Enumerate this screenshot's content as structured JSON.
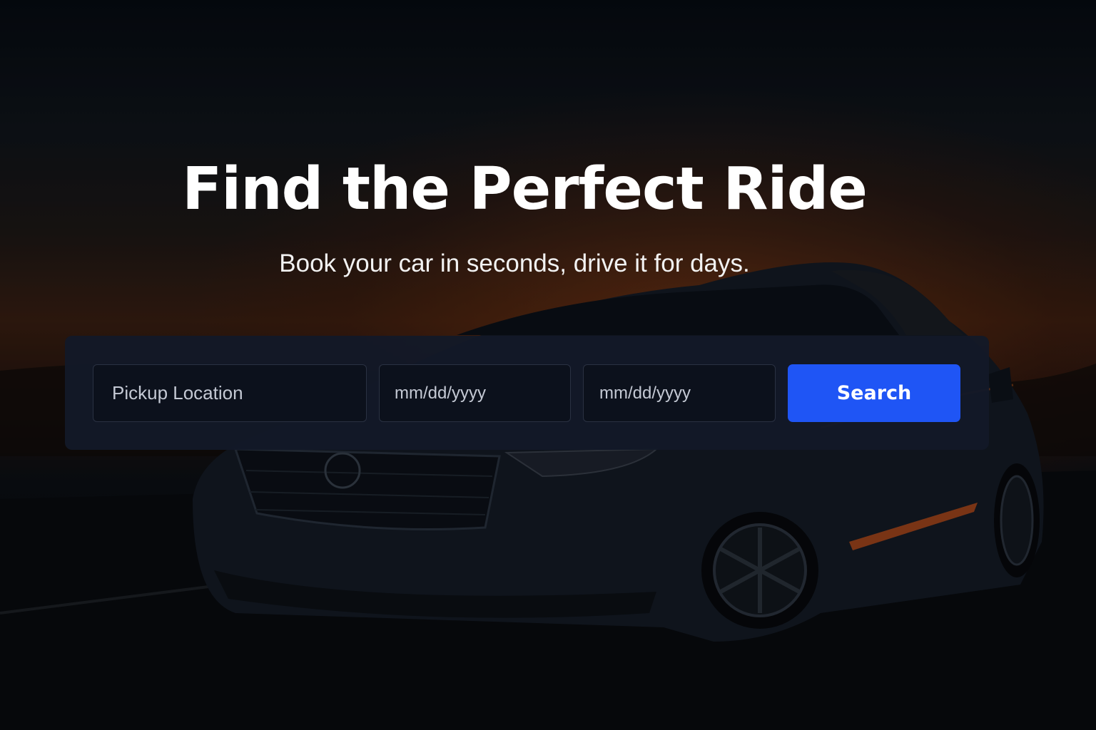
{
  "hero": {
    "title": "Find the Perfect Ride",
    "subtitle": "Book your car in seconds, drive it for days."
  },
  "search": {
    "location_placeholder": "Pickup Location",
    "pickup_date_placeholder": "mm/dd/yyyy",
    "return_date_placeholder": "mm/dd/yyyy",
    "button_label": "Search"
  },
  "colors": {
    "accent": "#1f55f5",
    "panel": "#131928",
    "field": "#0c111c"
  }
}
